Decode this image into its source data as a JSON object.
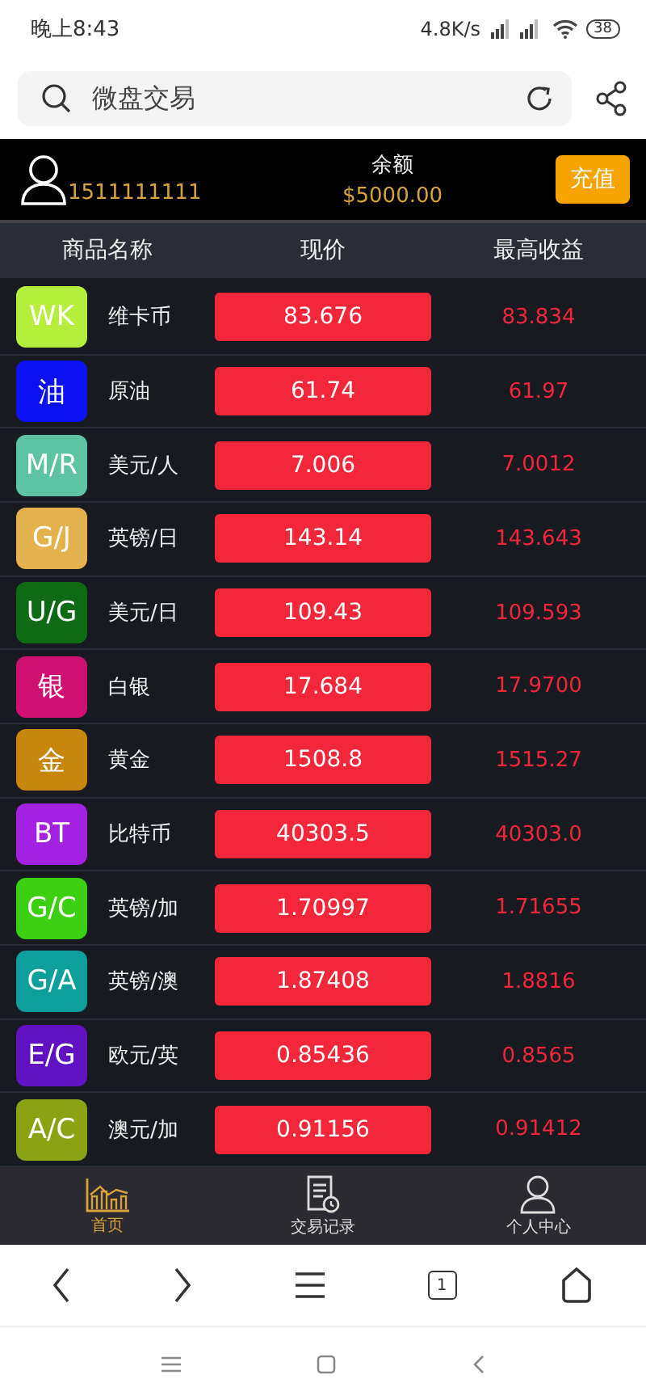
{
  "status_bar": {
    "time": "晚上8:43",
    "network_speed": "4.8K/s",
    "battery": "38"
  },
  "browser_bar": {
    "address": "微盘交易"
  },
  "account": {
    "phone": "1511111111",
    "balance_label": "余额",
    "balance": "$5000.00",
    "recharge_button": "充值"
  },
  "table": {
    "columns": [
      "商品名称",
      "现价",
      "最高收益"
    ],
    "rows": [
      {
        "badge": "WK",
        "color": "#b5ef3c",
        "name": "维卡币",
        "price": "83.676",
        "max_return": "83.834"
      },
      {
        "badge": "油",
        "color": "#0b10f2",
        "name": "原油",
        "price": "61.74",
        "max_return": "61.97"
      },
      {
        "badge": "M/R",
        "color": "#5ec3a2",
        "name": "美元/人",
        "price": "7.006",
        "max_return": "7.0012"
      },
      {
        "badge": "G/J",
        "color": "#e4b24c",
        "name": "英镑/日",
        "price": "143.14",
        "max_return": "143.643"
      },
      {
        "badge": "U/G",
        "color": "#0e6a14",
        "name": "美元/日",
        "price": "109.43",
        "max_return": "109.593"
      },
      {
        "badge": "银",
        "color": "#cf1070",
        "name": "白银",
        "price": "17.684",
        "max_return": "17.9700"
      },
      {
        "badge": "金",
        "color": "#c8870c",
        "name": "黄金",
        "price": "1508.8",
        "max_return": "1515.27"
      },
      {
        "badge": "BT",
        "color": "#a322e2",
        "name": "比特币",
        "price": "40303.5",
        "max_return": "40303.0"
      },
      {
        "badge": "G/C",
        "color": "#3cd012",
        "name": "英镑/加",
        "price": "1.70997",
        "max_return": "1.71655"
      },
      {
        "badge": "G/A",
        "color": "#0c9f9c",
        "name": "英镑/澳",
        "price": "1.87408",
        "max_return": "1.8816"
      },
      {
        "badge": "E/G",
        "color": "#6012c2",
        "name": "欧元/英",
        "price": "0.85436",
        "max_return": "0.8565"
      },
      {
        "badge": "A/C",
        "color": "#8ba212",
        "name": "澳元/加",
        "price": "0.91156",
        "max_return": "0.91412"
      }
    ]
  },
  "tab_bar": [
    {
      "label": "首页",
      "kind": "chart",
      "selected": true
    },
    {
      "label": "交易记录",
      "kind": "record",
      "selected": false
    },
    {
      "label": "个人中心",
      "kind": "person",
      "selected": false
    }
  ],
  "browser_nav": {
    "tab_count": "1"
  }
}
